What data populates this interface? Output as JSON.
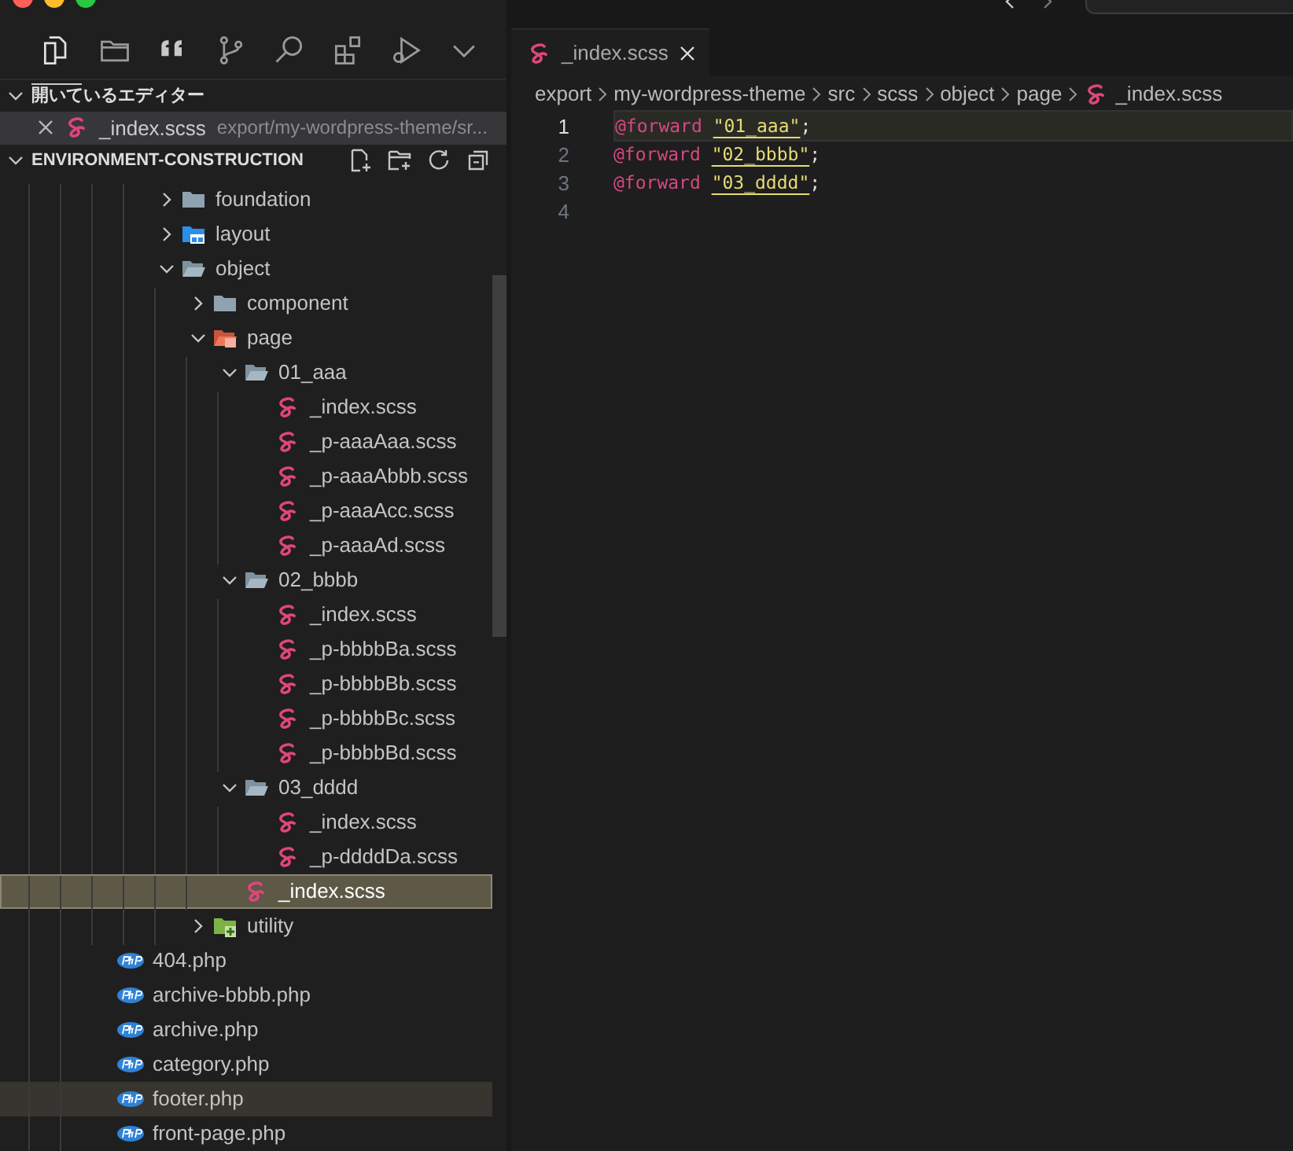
{
  "activity_bar": [
    {
      "kind": "explorer",
      "selected": true
    },
    {
      "kind": "folder",
      "selected": false
    },
    {
      "kind": "quote",
      "selected": false
    },
    {
      "kind": "source-control",
      "selected": false
    },
    {
      "kind": "search",
      "selected": false
    },
    {
      "kind": "extensions",
      "selected": false
    },
    {
      "kind": "run-debug",
      "selected": false
    },
    {
      "kind": "more",
      "selected": false
    }
  ],
  "sidebar": {
    "open_editors": {
      "title": "開いているエディター",
      "expanded": true,
      "items": [
        {
          "name": "_index.scss",
          "path": "export/my-wordpress-theme/sr...",
          "kind": "sass"
        }
      ]
    },
    "explorer": {
      "title": "ENVIRONMENT-CONSTRUCTION",
      "expanded": true,
      "nested_items": [
        {
          "name": "foundation",
          "kind": "folder",
          "expanded": false,
          "selected": false
        },
        {
          "name": "layout",
          "kind": "folder-layout",
          "expanded": false,
          "selected": false
        },
        {
          "name": "object",
          "kind": "folder",
          "expanded": true,
          "selected": false,
          "children": [
            {
              "name": "component",
              "kind": "folder",
              "expanded": false,
              "selected": false
            },
            {
              "name": "page",
              "kind": "folder-page",
              "expanded": true,
              "selected": false,
              "children": [
                {
                  "name": "01_aaa",
                  "kind": "folder",
                  "expanded": true,
                  "selected": false,
                  "children": [
                    {
                      "name": "_index.scss",
                      "kind": "sass",
                      "selected": false
                    },
                    {
                      "name": "_p-aaaAaa.scss",
                      "kind": "sass",
                      "selected": false
                    },
                    {
                      "name": "_p-aaaAbbb.scss",
                      "kind": "sass",
                      "selected": false
                    },
                    {
                      "name": "_p-aaaAcc.scss",
                      "kind": "sass",
                      "selected": false
                    },
                    {
                      "name": "_p-aaaAd.scss",
                      "kind": "sass",
                      "selected": false
                    }
                  ]
                },
                {
                  "name": "02_bbbb",
                  "kind": "folder",
                  "expanded": true,
                  "selected": false,
                  "children": [
                    {
                      "name": "_index.scss",
                      "kind": "sass",
                      "selected": false
                    },
                    {
                      "name": "_p-bbbbBa.scss",
                      "kind": "sass",
                      "selected": false
                    },
                    {
                      "name": "_p-bbbbBb.scss",
                      "kind": "sass",
                      "selected": false
                    },
                    {
                      "name": "_p-bbbbBc.scss",
                      "kind": "sass",
                      "selected": false
                    },
                    {
                      "name": "_p-bbbbBd.scss",
                      "kind": "sass",
                      "selected": false
                    }
                  ]
                },
                {
                  "name": "03_dddd",
                  "kind": "folder",
                  "expanded": true,
                  "selected": false,
                  "children": [
                    {
                      "name": "_index.scss",
                      "kind": "sass",
                      "selected": false
                    },
                    {
                      "name": "_p-ddddDa.scss",
                      "kind": "sass",
                      "selected": false
                    }
                  ]
                },
                {
                  "name": "_index.scss",
                  "kind": "sass",
                  "selected": true
                }
              ]
            },
            {
              "name": "utility",
              "kind": "folder-utility",
              "expanded": false,
              "selected": false
            }
          ]
        }
      ],
      "root_files": [
        {
          "name": "404.php",
          "kind": "php",
          "hovered": false
        },
        {
          "name": "archive-bbbb.php",
          "kind": "php",
          "hovered": false
        },
        {
          "name": "archive.php",
          "kind": "php",
          "hovered": false
        },
        {
          "name": "category.php",
          "kind": "php",
          "hovered": false
        },
        {
          "name": "footer.php",
          "kind": "php",
          "hovered": true
        },
        {
          "name": "front-page.php",
          "kind": "php",
          "hovered": false
        }
      ]
    }
  },
  "editor": {
    "tabs": [
      {
        "label": "_index.scss",
        "kind": "sass",
        "selected": true
      }
    ],
    "breadcrumbs": [
      {
        "label": "export"
      },
      {
        "label": "my-wordpress-theme"
      },
      {
        "label": "src"
      },
      {
        "label": "scss"
      },
      {
        "label": "object"
      },
      {
        "label": "page"
      },
      {
        "label": "_index.scss",
        "kind": "sass"
      }
    ],
    "lines": [
      {
        "number": "1",
        "current": true,
        "tokens": [
          {
            "kind": "keyword",
            "text": "@forward"
          },
          {
            "kind": "string",
            "text": "\"01_aaa\""
          },
          {
            "kind": "punct",
            "text": ";"
          }
        ]
      },
      {
        "number": "2",
        "current": false,
        "tokens": [
          {
            "kind": "keyword",
            "text": "@forward"
          },
          {
            "kind": "string",
            "text": "\"02_bbbb\""
          },
          {
            "kind": "punct",
            "text": ";"
          }
        ]
      },
      {
        "number": "3",
        "current": false,
        "tokens": [
          {
            "kind": "keyword",
            "text": "@forward"
          },
          {
            "kind": "string",
            "text": "\"03_dddd\""
          },
          {
            "kind": "punct",
            "text": ";"
          }
        ]
      },
      {
        "number": "4",
        "current": false
      }
    ]
  }
}
